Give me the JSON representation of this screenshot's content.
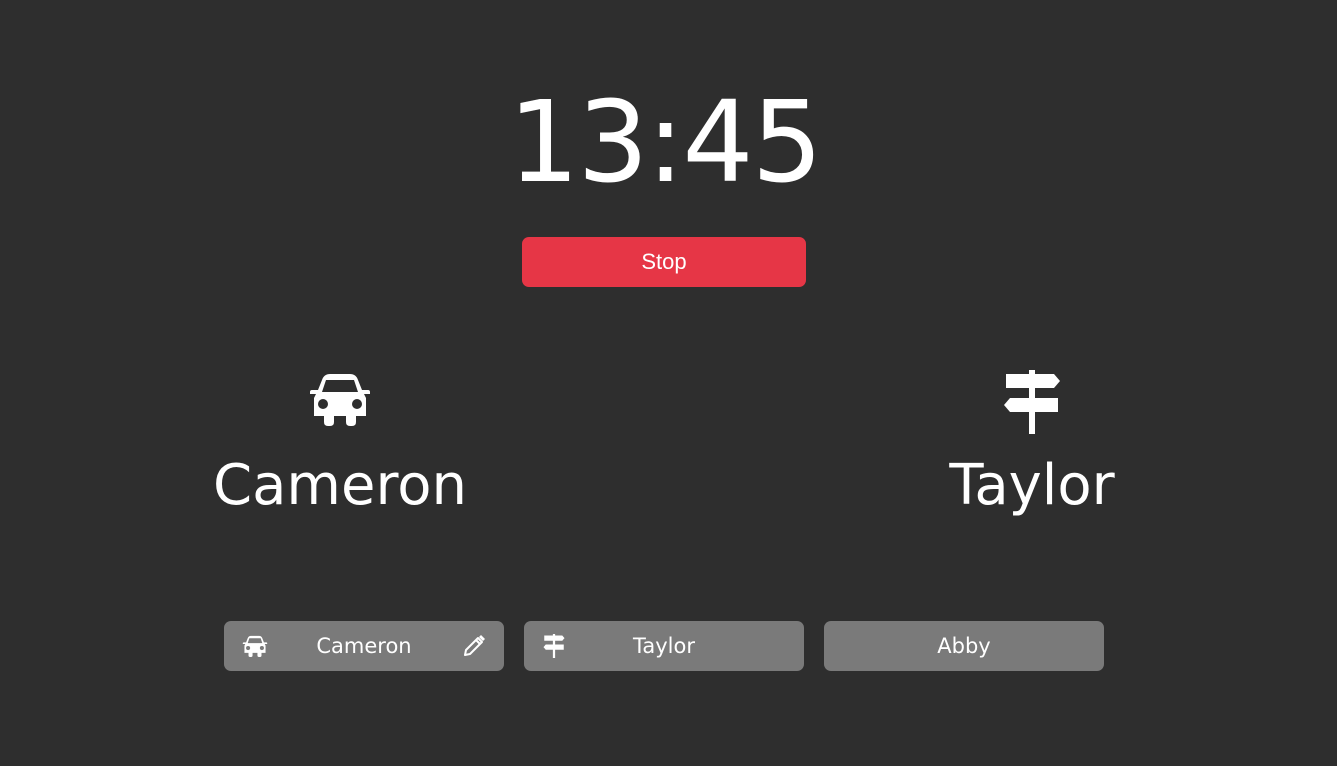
{
  "timer": {
    "display": "13:45"
  },
  "controls": {
    "stop_label": "Stop"
  },
  "roles": {
    "driver": {
      "name": "Cameron",
      "icon": "car-icon"
    },
    "navigator": {
      "name": "Taylor",
      "icon": "signpost-icon"
    }
  },
  "participants": [
    {
      "name": "Cameron",
      "icon": "car-icon",
      "edit_icon": "pencil-icon"
    },
    {
      "name": "Taylor",
      "icon": "signpost-icon"
    },
    {
      "name": "Abby"
    }
  ],
  "colors": {
    "background": "#2e2e2e",
    "stop_button": "#e63646",
    "chip": "#7a7a7a",
    "text": "#ffffff"
  }
}
